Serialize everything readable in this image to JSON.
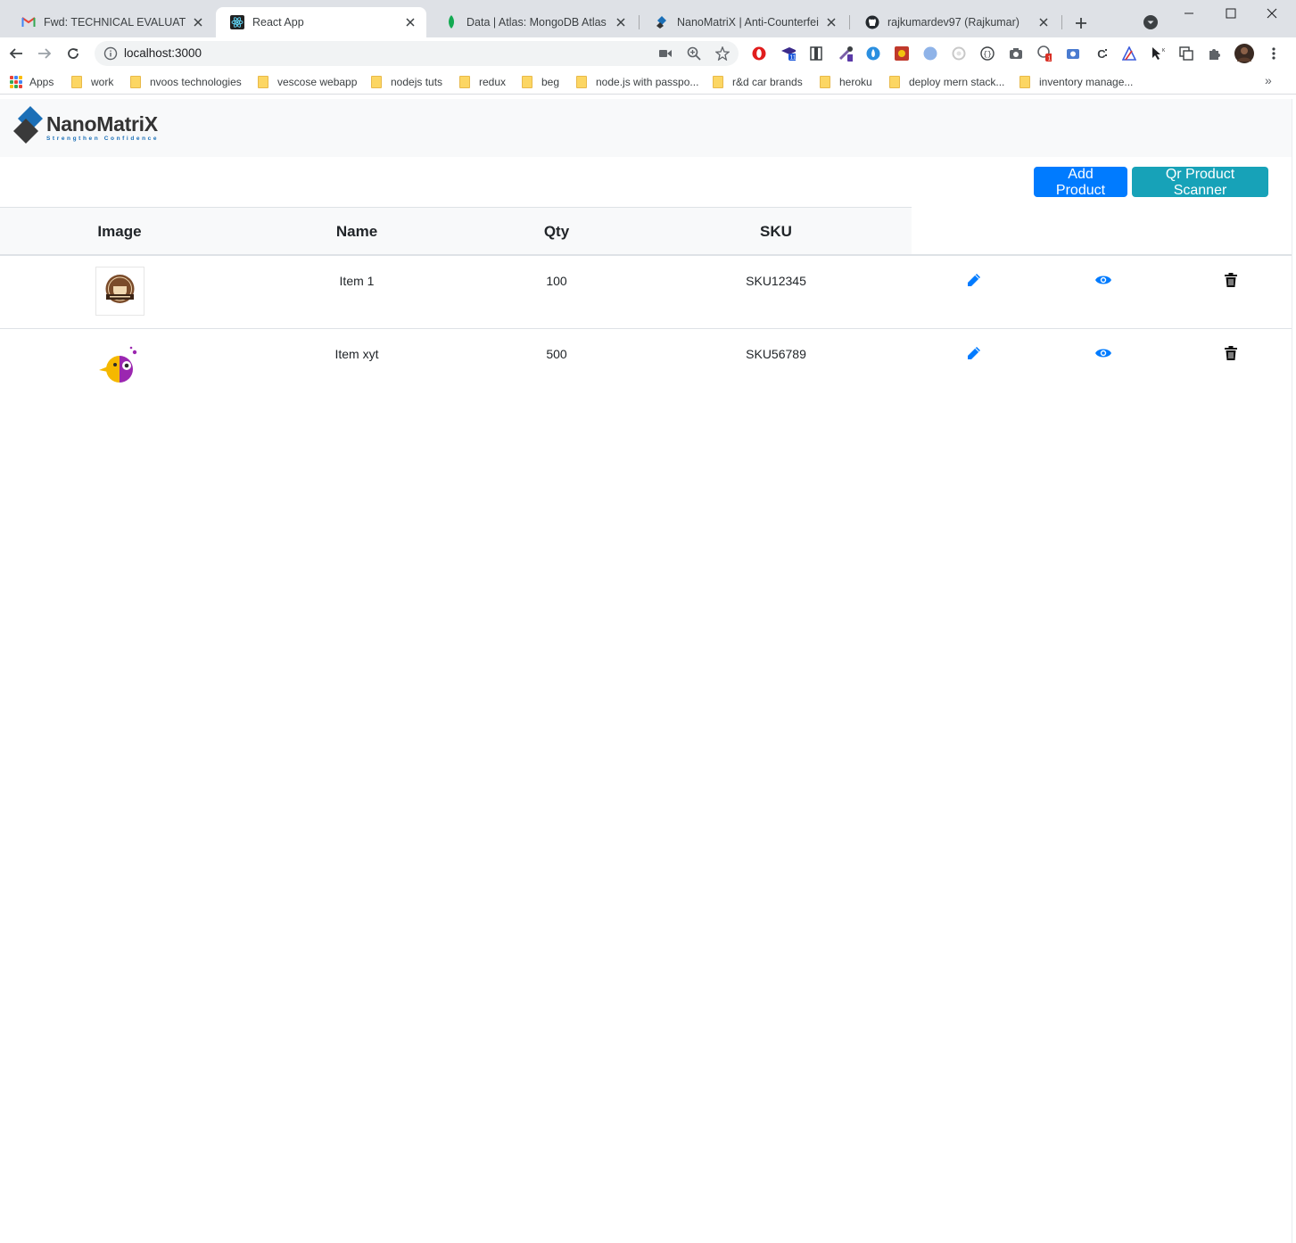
{
  "browser": {
    "tabs": [
      {
        "title": "Fwd: TECHNICAL EVALUATION E",
        "icon": "gmail-icon",
        "active": false
      },
      {
        "title": "React App",
        "icon": "react-icon",
        "active": true
      },
      {
        "title": "Data | Atlas: MongoDB Atlas",
        "icon": "mongodb-leaf-icon",
        "active": false
      },
      {
        "title": "NanoMatriX | Anti-Counterfeiting",
        "icon": "nanomatrix-icon",
        "active": false
      },
      {
        "title": "rajkumardev97 (Rajkumar)",
        "icon": "github-icon",
        "active": false
      }
    ],
    "url": "localhost:3000",
    "bookmarks": [
      "Apps",
      "work",
      "nvoos technologies",
      "vescose webapp",
      "nodejs tuts",
      "redux",
      "beg",
      "node.js with passpo...",
      "r&d car brands",
      "heroku",
      "deploy mern stack...",
      "inventory manage..."
    ],
    "extension_badges": {
      "graduation": "11",
      "chat": "1"
    }
  },
  "app": {
    "logo": {
      "word": "NanoMatriX",
      "tagline": "Strengthen Confidence"
    },
    "buttons": {
      "add_product": "Add Product",
      "qr_scanner": "Qr Product Scanner"
    },
    "table": {
      "headers": [
        "Image",
        "Name",
        "Qty",
        "SKU"
      ],
      "rows": [
        {
          "name": "Item 1",
          "qty": "100",
          "sku": "SKU12345",
          "image": "coffee-badge-logo"
        },
        {
          "name": "Item xyt",
          "qty": "500",
          "sku": "SKU56789",
          "image": "bird-logo"
        }
      ]
    },
    "colors": {
      "primary": "#007bff",
      "info": "#17a2b8",
      "navbar": "#f8f9fa",
      "icon_blue": "#007bff"
    }
  }
}
